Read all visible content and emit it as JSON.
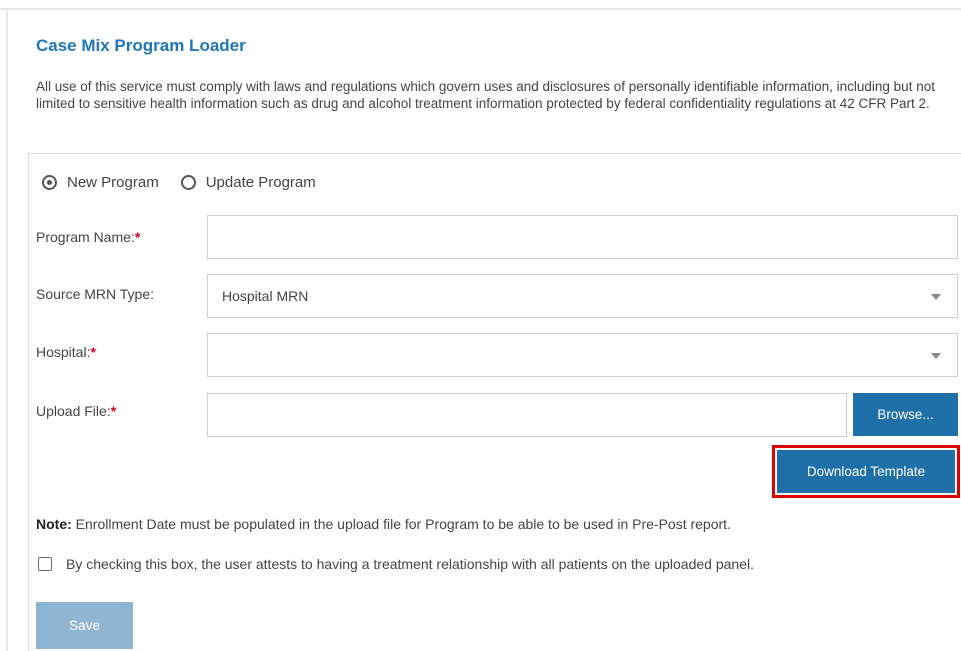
{
  "page": {
    "title": "Case Mix Program Loader",
    "disclaimer": "All use of this service must comply with laws and regulations which govern uses and disclosures of personally identifiable information, including but not limited to sensitive health information such as drug and alcohol treatment information protected by federal confidentiality regulations at 42 CFR Part 2."
  },
  "form": {
    "mode_options": [
      {
        "label": "New Program",
        "checked": true
      },
      {
        "label": "Update Program",
        "checked": false
      }
    ],
    "program_name": {
      "label": "Program Name:",
      "required_mark": "*",
      "value": ""
    },
    "source_mrn_type": {
      "label": "Source MRN Type:",
      "selected": "Hospital MRN"
    },
    "hospital": {
      "label": "Hospital:",
      "required_mark": "*",
      "selected": ""
    },
    "upload_file": {
      "label": "Upload File:",
      "required_mark": "*",
      "value": ""
    },
    "browse_label": "Browse...",
    "download_template_label": "Download Template",
    "note_prefix": "Note:",
    "note_text": " Enrollment Date must be populated in the upload file for Program to be able to be used in Pre-Post report.",
    "attest_text": "By checking this box, the user attests to having a treatment relationship with all patients on the uploaded panel.",
    "save_label": "Save"
  },
  "colors": {
    "title": "#1f77b8",
    "primary_button": "#1f6fa8",
    "disabled_button": "#8fb5d3",
    "required": "#d0021b",
    "highlight": "#e00000"
  }
}
